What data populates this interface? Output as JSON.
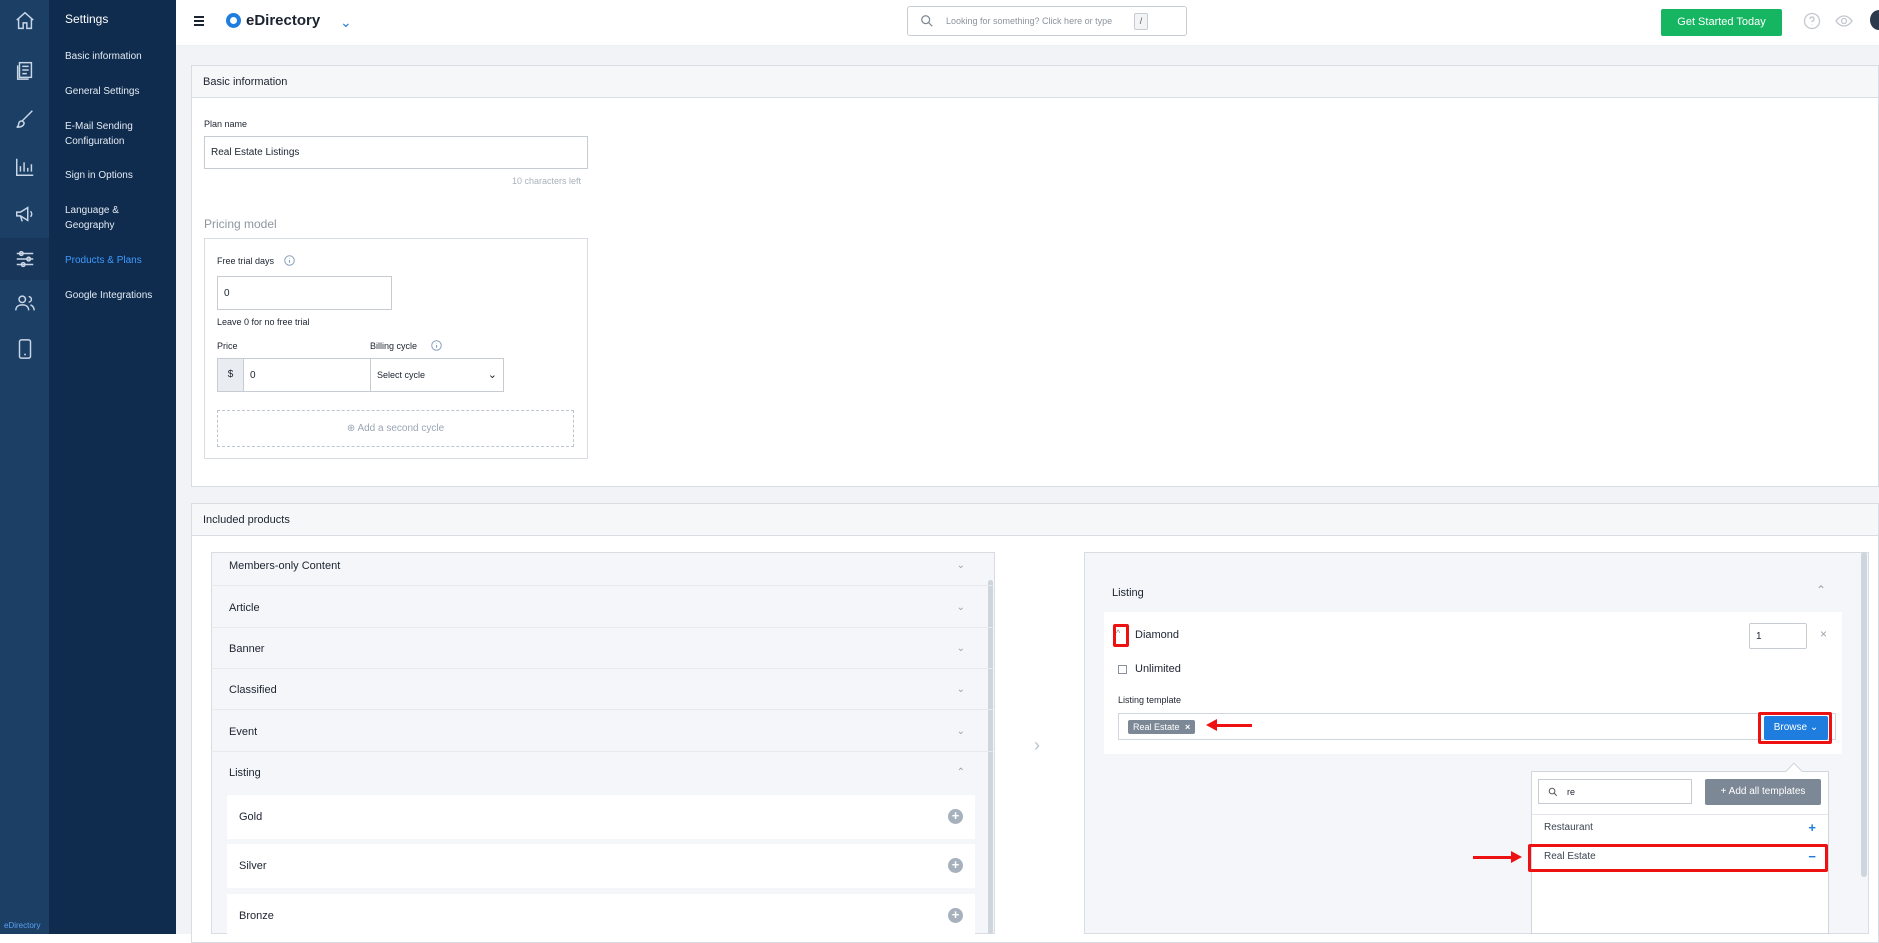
{
  "sidebar": {
    "title": "Settings",
    "items": [
      {
        "label": "Basic information"
      },
      {
        "label": "General Settings"
      },
      {
        "label": "E-Mail Sending Configuration"
      },
      {
        "label": "Sign in Options"
      },
      {
        "label": "Language & Geography"
      },
      {
        "label": "Products & Plans"
      },
      {
        "label": "Google Integrations"
      }
    ],
    "brand": "eDirectory"
  },
  "header": {
    "app_name": "eDirectory",
    "search_placeholder": "Looking for something? Click here or type",
    "search_key": "/",
    "cta": "Get Started Today"
  },
  "basic": {
    "section_title": "Basic information",
    "plan_label": "Plan name",
    "plan_value": "Real Estate Listings",
    "chars_left": "10 characters left",
    "pricing_title": "Pricing model",
    "trial_label": "Free trial days",
    "trial_value": "0",
    "trial_hint": "Leave 0 for no free trial",
    "price_label": "Price",
    "currency": "$",
    "price_value": "0",
    "cycle_label": "Billing cycle",
    "cycle_selected": "Select cycle",
    "add_cycle": "Add a second cycle"
  },
  "included": {
    "section_title": "Included products",
    "products": [
      {
        "label": "Members-only Content"
      },
      {
        "label": "Article"
      },
      {
        "label": "Banner"
      },
      {
        "label": "Classified"
      },
      {
        "label": "Event"
      },
      {
        "label": "Listing"
      }
    ],
    "listing_levels": [
      {
        "label": "Gold"
      },
      {
        "label": "Silver"
      },
      {
        "label": "Bronze"
      }
    ]
  },
  "selected": {
    "group_title": "Listing",
    "level_name": "Diamond",
    "quantity": "1",
    "unlimited_label": "Unlimited",
    "template_label": "Listing template",
    "template_tag": "Real Estate",
    "browse_label": "Browse",
    "dropdown": {
      "search_value": "re",
      "add_all": "+ Add all templates",
      "options": [
        {
          "label": "Restaurant",
          "action": "+"
        },
        {
          "label": "Real Estate",
          "action": "−"
        }
      ]
    }
  },
  "colors": {
    "accent": "#1f7de0",
    "cta": "#15b562",
    "highlight": "#e11111"
  }
}
